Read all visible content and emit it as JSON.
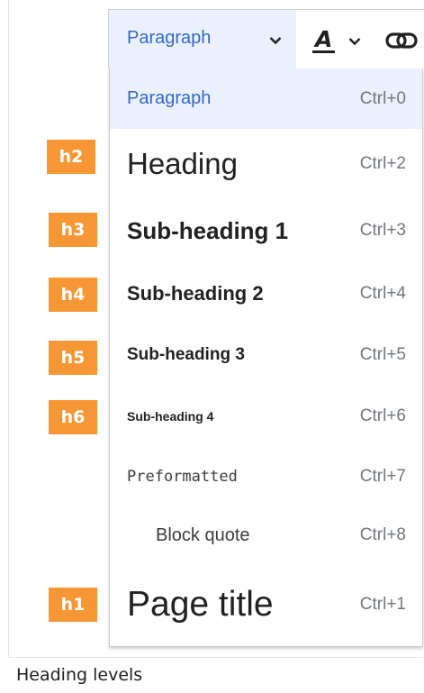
{
  "toolbar": {
    "format_select_label": "Paragraph",
    "text_style_icon": "text-style-a-icon",
    "link_icon": "link-icon"
  },
  "menu": {
    "items": [
      {
        "label": "Paragraph",
        "shortcut": "Ctrl+0",
        "selected": true
      },
      {
        "label": "Heading",
        "shortcut": "Ctrl+2",
        "tag": "h2"
      },
      {
        "label": "Sub-heading 1",
        "shortcut": "Ctrl+3",
        "tag": "h3"
      },
      {
        "label": "Sub-heading 2",
        "shortcut": "Ctrl+4",
        "tag": "h4"
      },
      {
        "label": "Sub-heading 3",
        "shortcut": "Ctrl+5",
        "tag": "h5"
      },
      {
        "label": "Sub-heading 4",
        "shortcut": "Ctrl+6",
        "tag": "h6"
      },
      {
        "label": "Preformatted",
        "shortcut": "Ctrl+7"
      },
      {
        "label": "Block quote",
        "shortcut": "Ctrl+8"
      },
      {
        "label": "Page title",
        "shortcut": "Ctrl+1",
        "tag": "h1"
      }
    ]
  },
  "caption": "Heading levels",
  "colors": {
    "accent": "#3366cc",
    "tag_orange": "#f79634",
    "selected_bg": "#eaf1fd"
  }
}
